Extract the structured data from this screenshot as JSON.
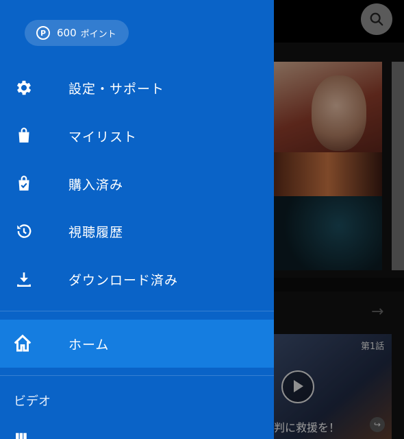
{
  "drawer": {
    "points": {
      "value": "600",
      "unit": "ポイント",
      "icon": "P"
    },
    "menu": [
      {
        "label": "設定・サポート",
        "icon": "gear-icon"
      },
      {
        "label": "マイリスト",
        "icon": "bag-icon"
      },
      {
        "label": "購入済み",
        "icon": "bag-check-icon"
      },
      {
        "label": "視聴履歴",
        "icon": "history-icon"
      },
      {
        "label": "ダウンロード済み",
        "icon": "download-icon"
      }
    ],
    "home": {
      "label": "ホーム",
      "icon": "home-icon"
    },
    "section": "ビデオ"
  },
  "background": {
    "episode_badge": "第1話",
    "caption": "判に救援を！"
  },
  "colors": {
    "drawer": "#0a63c7",
    "home_highlight": "#157de0"
  }
}
